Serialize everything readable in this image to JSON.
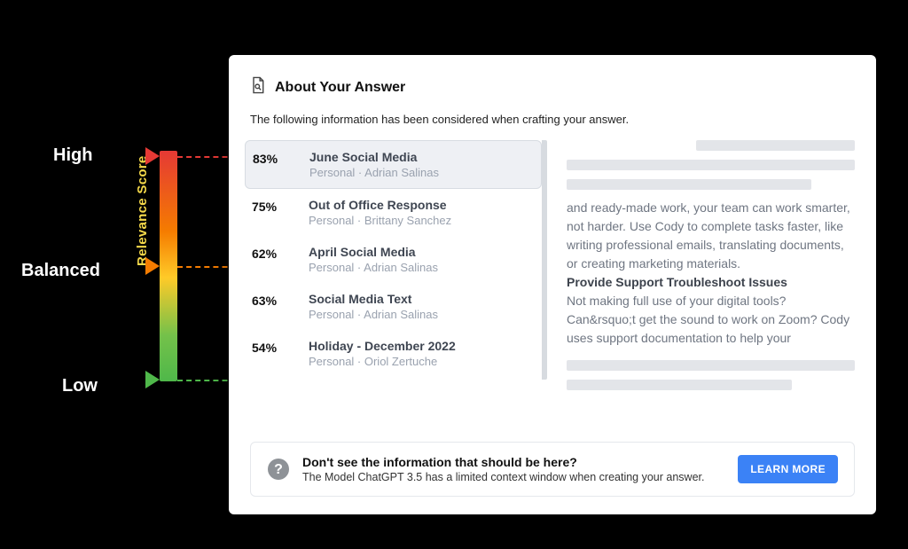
{
  "gauge": {
    "high": "High",
    "balanced": "Balanced",
    "low": "Low",
    "caption": "Relevance Score",
    "colors": {
      "high": "#e53935",
      "mid": "#f57c00",
      "low": "#4fb84a"
    }
  },
  "panel": {
    "title": "About Your Answer",
    "subtitle": "The following information has been considered when crafting your answer."
  },
  "sources": [
    {
      "score": "83%",
      "title": "June Social Media",
      "meta": "Personal · Adrian Salinas",
      "selected": true
    },
    {
      "score": "75%",
      "title": "Out of Office Response",
      "meta": "Personal · Brittany Sanchez",
      "selected": false
    },
    {
      "score": "62%",
      "title": "April Social Media",
      "meta": "Personal · Adrian Salinas",
      "selected": false
    },
    {
      "score": "63%",
      "title": "Social Media Text",
      "meta": "Personal · Adrian Salinas",
      "selected": false
    },
    {
      "score": "54%",
      "title": "Holiday - December 2022",
      "meta": "Personal · Oriol Zertuche",
      "selected": false
    }
  ],
  "preview": {
    "p1": " and ready-made work, your team can work smarter, not harder. Use Cody to complete tasks faster, like writing professional emails, translating documents, or creating marketing materials.",
    "h1": "Provide Support Troubleshoot Issues",
    "p2": "Not making full use of your digital tools? Can&rsquo;t get the sound to work on Zoom? Cody uses support documentation to help your"
  },
  "footer": {
    "title": "Don't see the information that should be here?",
    "sub": "The Model ChatGPT 3.5 has a limited context window when creating your answer.",
    "button": "LEARN MORE"
  }
}
